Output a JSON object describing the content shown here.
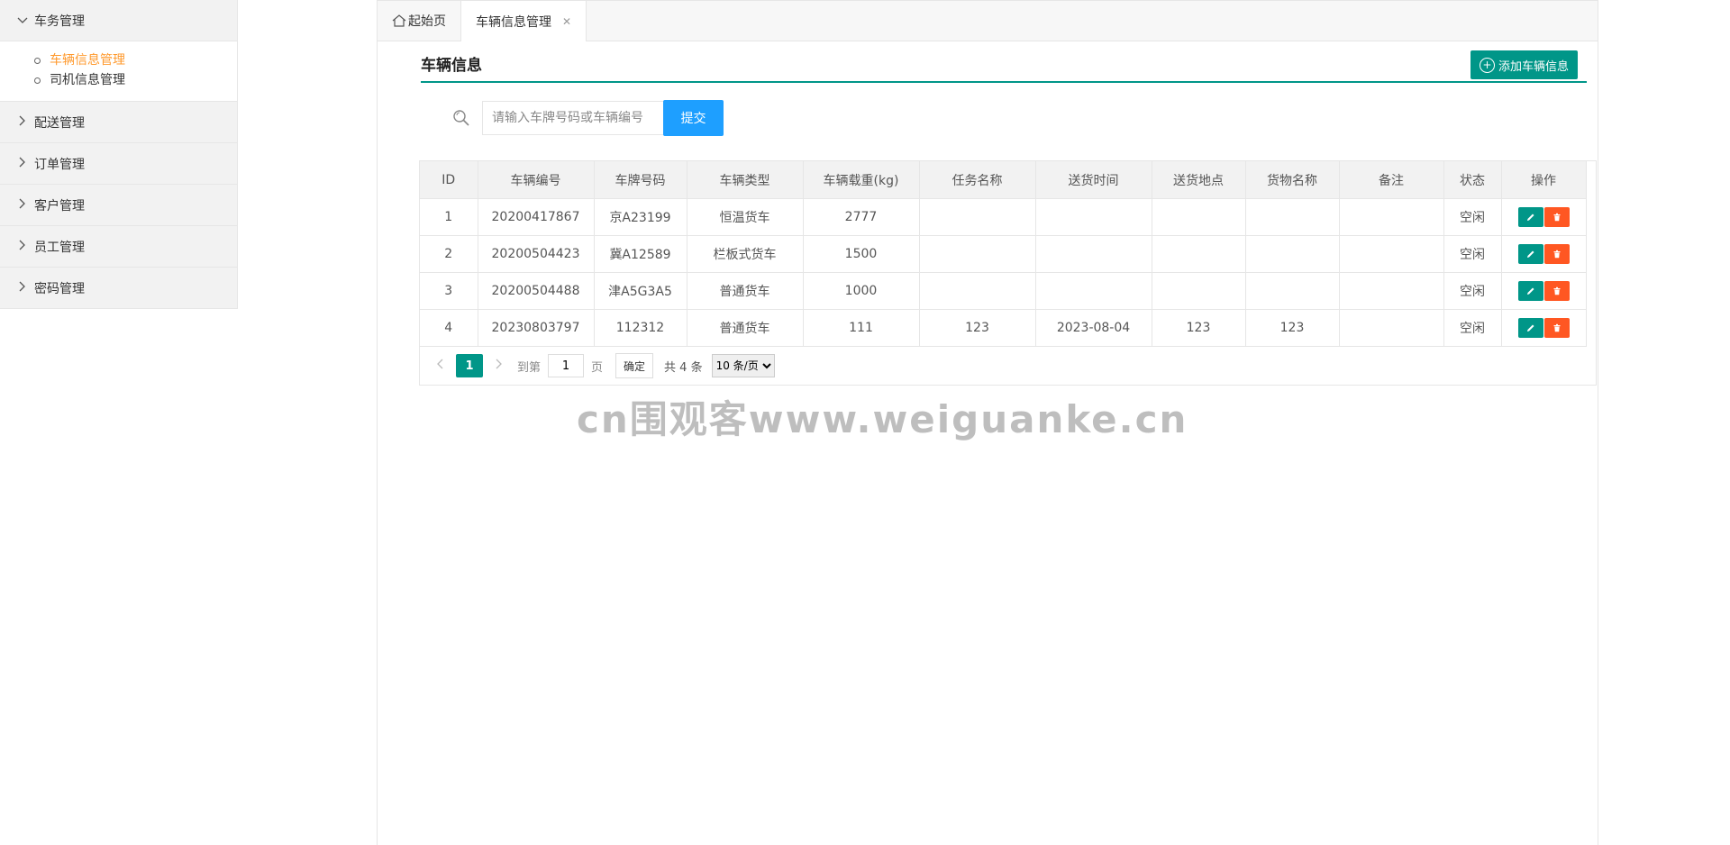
{
  "sidebar": {
    "groups": [
      {
        "label": "车务管理",
        "expanded": true,
        "items": [
          {
            "label": "车辆信息管理",
            "active": true
          },
          {
            "label": "司机信息管理",
            "active": false
          }
        ]
      },
      {
        "label": "配送管理",
        "expanded": false
      },
      {
        "label": "订单管理",
        "expanded": false
      },
      {
        "label": "客户管理",
        "expanded": false
      },
      {
        "label": "员工管理",
        "expanded": false
      },
      {
        "label": "密码管理",
        "expanded": false
      }
    ]
  },
  "tabs": [
    {
      "label": "起始页",
      "icon": "home-icon"
    },
    {
      "label": "车辆信息管理",
      "active": true,
      "closable": true,
      "close_glyph": "✕"
    }
  ],
  "header": {
    "title": "车辆信息",
    "add_button": "添加车辆信息"
  },
  "search": {
    "placeholder": "请输入车牌号码或车辆编号",
    "submit": "提交"
  },
  "table": {
    "columns": [
      "ID",
      "车辆编号",
      "车牌号码",
      "车辆类型",
      "车辆载重(kg)",
      "任务名称",
      "送货时间",
      "送货地点",
      "货物名称",
      "备注",
      "状态",
      "操作"
    ],
    "rows": [
      [
        "1",
        "20200417867",
        "京A23199",
        "恒温货车",
        "2777",
        "",
        "",
        "",
        "",
        "",
        "空闲"
      ],
      [
        "2",
        "20200504423",
        "冀A12589",
        "栏板式货车",
        "1500",
        "",
        "",
        "",
        "",
        "",
        "空闲"
      ],
      [
        "3",
        "20200504488",
        "津A5G3A5",
        "普通货车",
        "1000",
        "",
        "",
        "",
        "",
        "",
        "空闲"
      ],
      [
        "4",
        "20230803797",
        "112312",
        "普通货车",
        "111",
        "123",
        "2023-08-04",
        "123",
        "123",
        "",
        "空闲"
      ]
    ]
  },
  "pager": {
    "current_page": "1",
    "goto_label": "到第",
    "goto_value": "1",
    "page_unit": "页",
    "confirm": "确定",
    "total": "共 4 条",
    "page_size": "10 条/页"
  },
  "watermark": "cn围观客www.weiguanke.cn",
  "colors": {
    "primary": "#009688",
    "submit": "#1e9fff",
    "danger": "#ff5722",
    "active_menu": "#ff9a2e"
  }
}
